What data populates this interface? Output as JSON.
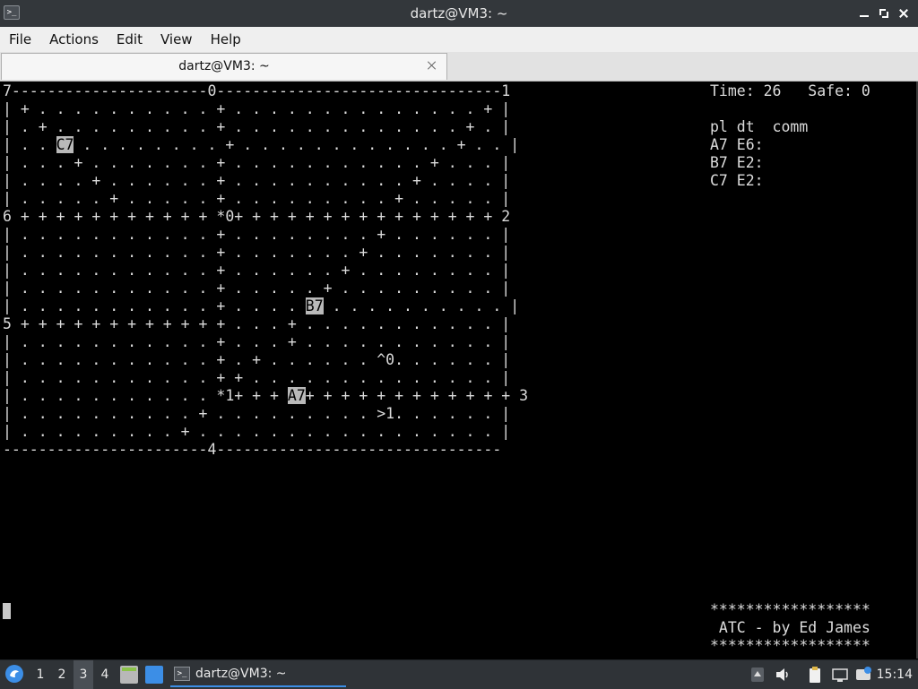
{
  "window": {
    "title": "dartz@VM3: ~"
  },
  "menu": [
    "File",
    "Actions",
    "Edit",
    "View",
    "Help"
  ],
  "tab": {
    "label": "dartz@VM3: ~"
  },
  "game": {
    "board_rows": [
      [
        "7----------------------0--------------------------------1"
      ],
      [
        "| + . . . . . . . . . . + . . . . . . . . . . . . . . + |"
      ],
      [
        "| . + . . . . . . . . . + . . . . . . . . . . . . . + . |"
      ],
      [
        "| . . ",
        {
          "t": "C7",
          "hl": true
        },
        " . . . . . . . . + . . . . . . . . . . . . + . . |"
      ],
      [
        "| . . . + . . . . . . . + . . . . . . . . . . . + . . . |"
      ],
      [
        "| . . . . + . . . . . . + . . . . . . . . . . + . . . . |"
      ],
      [
        "| . . . . . + . . . . . + . . . . . . . . . + . . . . . |"
      ],
      [
        "6 + + + + + + + + + + + *0+ + + + + + + + + + + + + + + 2"
      ],
      [
        "| . . . . . . . . . . . + . . . . . . . . + . . . . . . |"
      ],
      [
        "| . . . . . . . . . . . + . . . . . . . + . . . . . . . |"
      ],
      [
        "| . . . . . . . . . . . + . . . . . . + . . . . . . . . |"
      ],
      [
        "| . . . . . . . . . . . + . . . . . + . . . . . . . . . |"
      ],
      [
        "| . . . . . . . . . . . + . . . . ",
        {
          "t": "B7",
          "hl": true
        },
        " . . . . . . . . . . |"
      ],
      [
        "5 + + + + + + + + + + + + . . . + . . . . . . . . . . . |"
      ],
      [
        "| . . . . . . . . . . . + . . . + . . . . . . . . . . . |"
      ],
      [
        "| . . . . . . . . . . . + . + . . . . . . ^0. . . . . . |"
      ],
      [
        "| . . . . . . . . . . . + + . . . . . . . . . . . . . . |"
      ],
      [
        "| . . . . . . . . . . . *1+ + + ",
        {
          "t": "A7",
          "hl": true
        },
        "+ + + + + + + + + + + + 3"
      ],
      [
        "| . . . . . . . . . . + . . . . . . . . . >1. . . . . . |"
      ],
      [
        "| . . . . . . . . . + . . . . . . . . . . . . . . . . . |"
      ],
      [
        "-----------------------4--------------------------------"
      ]
    ],
    "status": {
      "time_label": "Time:",
      "time": "26",
      "safe_label": "Safe:",
      "safe": "0"
    },
    "table_header": "pl dt  comm",
    "planes": [
      "A7 E6:",
      "B7 E2:",
      "C7 E2:"
    ],
    "banner": [
      "******************",
      " ATC - by Ed James",
      "******************"
    ]
  },
  "taskbar": {
    "workspaces": [
      "1",
      "2",
      "3",
      "4"
    ],
    "active_workspace": "3",
    "task_label": "dartz@VM3: ~",
    "clock": "15:14"
  },
  "colors": {
    "titlebar": "#33373b",
    "menubar": "#efefef",
    "terminal_bg": "#000000",
    "highlight": "#b9b9b9",
    "accent": "#3c8ee6"
  }
}
